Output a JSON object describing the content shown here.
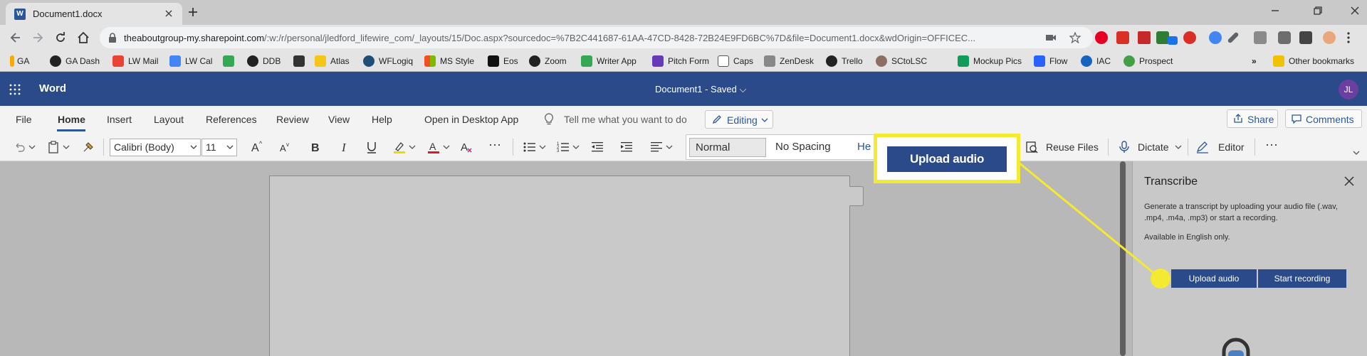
{
  "browser": {
    "tab_title": "Document1.docx",
    "url_host": "theaboutgroup-my.sharepoint.com",
    "url_path": "/:w:/r/personal/jledford_lifewire_com/_layouts/15/Doc.aspx?sourcedoc=%7B2C441687-61AA-47CD-8428-72B24E9FD6BC%7D&file=Document1.docx&wdOrigin=OFFICEC...",
    "bookmarks": [
      "GA",
      "GA Dash",
      "LW Mail",
      "LW Cal",
      "DDB",
      "Atlas",
      "WFLogiq",
      "MS Style",
      "Eos",
      "Zoom",
      "Writer App",
      "Pitch Form",
      "Caps",
      "ZenDesk",
      "Trello",
      "SCtoLSC",
      "Mockup Pics",
      "Flow",
      "IAC",
      "Prospect"
    ],
    "other_bookmarks": "Other bookmarks",
    "overflow": "»"
  },
  "word": {
    "app_name": "Word",
    "doc_title": "Document1  -  Saved ⌵",
    "avatar": "JL"
  },
  "ribbon": {
    "tabs": [
      "File",
      "Home",
      "Insert",
      "Layout",
      "References",
      "Review",
      "View",
      "Help",
      "Open in Desktop App"
    ],
    "tell_me": "Tell me what you want to do",
    "editing": "Editing",
    "share": "Share",
    "comments": "Comments",
    "font": "Calibri (Body)",
    "size": "11",
    "style_normal": "Normal",
    "style_nospacing": "No Spacing",
    "style_heading": "He",
    "reuse_files": "Reuse Files",
    "dictate": "Dictate",
    "editor": "Editor",
    "more": "···"
  },
  "transcribe": {
    "title": "Transcribe",
    "description": "Generate a transcript by uploading your audio file (.wav, .mp4, .m4a, .mp3) or start a recording.",
    "note": "Available in English only.",
    "upload_button": "Upload audio",
    "record_button": "Start recording"
  },
  "callout": {
    "label": "Upload audio",
    "highlight_color": "#f5ea32"
  },
  "colors": {
    "word_blue": "#2b4a8a",
    "accent": "#2b579a"
  }
}
